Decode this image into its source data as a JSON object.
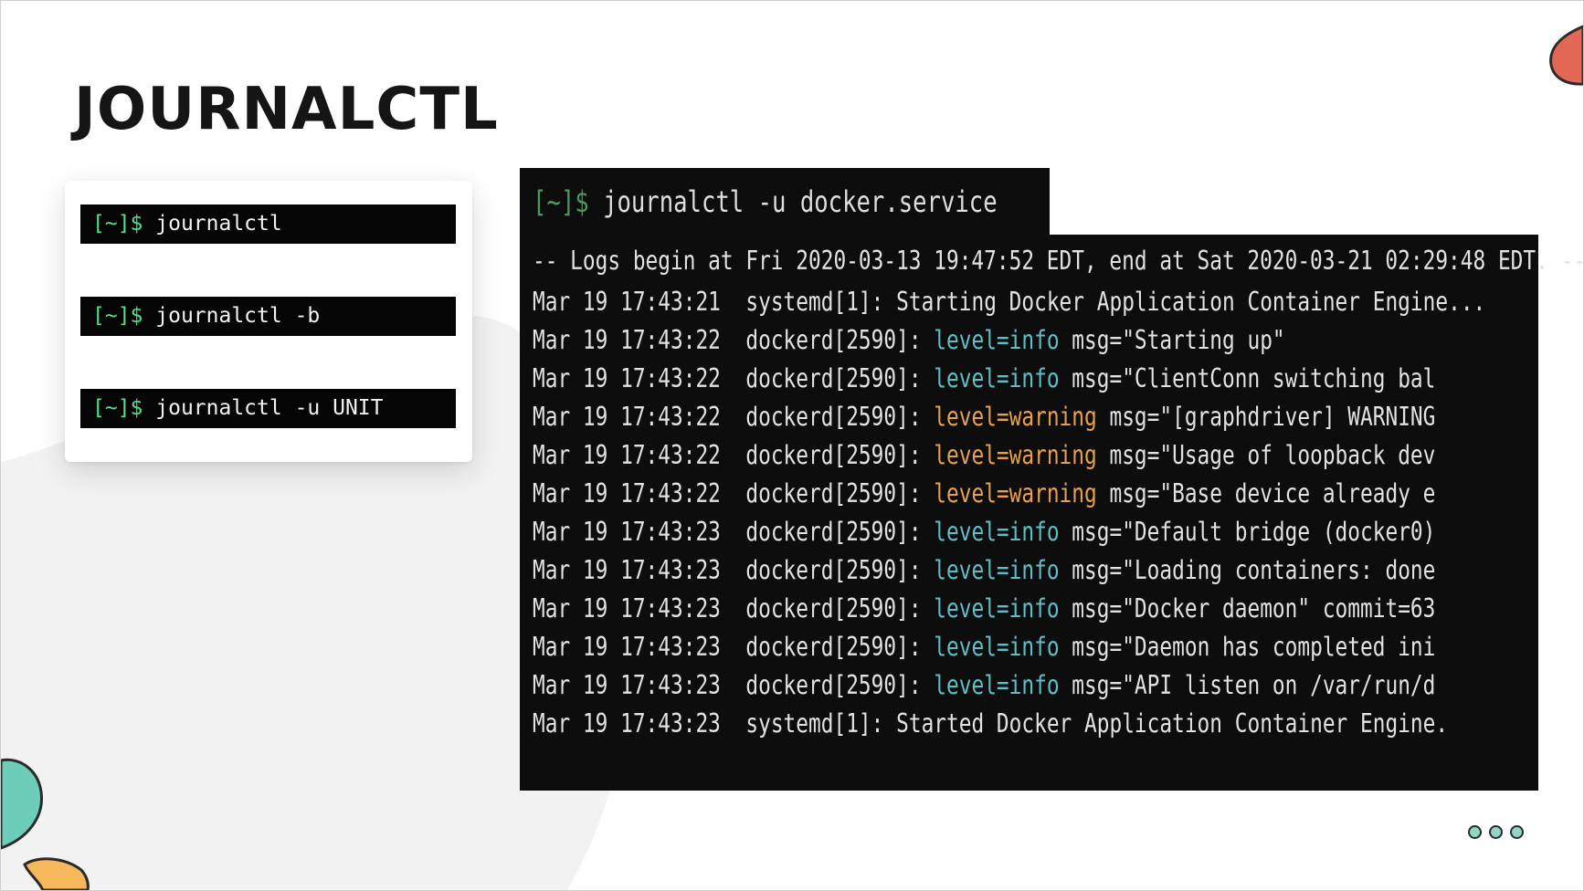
{
  "slide": {
    "title": "JOURNALCTL",
    "accent_colors": {
      "teal": "#6ccdb9",
      "orange": "#f6b85a",
      "red": "#e36755"
    }
  },
  "commands": [
    {
      "prompt": "[~]$",
      "command": "journalctl"
    },
    {
      "prompt": "[~]$",
      "command": "journalctl -b"
    },
    {
      "prompt": "[~]$",
      "command": "journalctl -u UNIT"
    }
  ],
  "terminal": {
    "prompt": "[~]$",
    "command": "journalctl -u docker.service",
    "header_line": "-- Logs begin at Fri 2020-03-13 19:47:52 EDT, end at Sat 2020-03-21 02:29:48 EDT. --",
    "lines": [
      {
        "ts": "Mar 19 17:43:21",
        "src": "systemd[1]:",
        "level": "",
        "msg": "Starting Docker Application Container Engine..."
      },
      {
        "ts": "Mar 19 17:43:22",
        "src": "dockerd[2590]:",
        "level": "level=info",
        "msg": "msg=\"Starting up\""
      },
      {
        "ts": "Mar 19 17:43:22",
        "src": "dockerd[2590]:",
        "level": "level=info",
        "msg": "msg=\"ClientConn switching bal"
      },
      {
        "ts": "Mar 19 17:43:22",
        "src": "dockerd[2590]:",
        "level": "level=warning",
        "msg": "msg=\"[graphdriver] WARNING"
      },
      {
        "ts": "Mar 19 17:43:22",
        "src": "dockerd[2590]:",
        "level": "level=warning",
        "msg": "msg=\"Usage of loopback dev"
      },
      {
        "ts": "Mar 19 17:43:22",
        "src": "dockerd[2590]:",
        "level": "level=warning",
        "msg": "msg=\"Base device already e"
      },
      {
        "ts": "Mar 19 17:43:23",
        "src": "dockerd[2590]:",
        "level": "level=info",
        "msg": "msg=\"Default bridge (docker0)"
      },
      {
        "ts": "Mar 19 17:43:23",
        "src": "dockerd[2590]:",
        "level": "level=info",
        "msg": "msg=\"Loading containers: done"
      },
      {
        "ts": "Mar 19 17:43:23",
        "src": "dockerd[2590]:",
        "level": "level=info",
        "msg": "msg=\"Docker daemon\" commit=63"
      },
      {
        "ts": "Mar 19 17:43:23",
        "src": "dockerd[2590]:",
        "level": "level=info",
        "msg": "msg=\"Daemon has completed ini"
      },
      {
        "ts": "Mar 19 17:43:23",
        "src": "dockerd[2590]:",
        "level": "level=info",
        "msg": "msg=\"API listen on /var/run/d"
      },
      {
        "ts": "Mar 19 17:43:23",
        "src": "systemd[1]:",
        "level": "",
        "msg": "Started Docker Application Container Engine."
      }
    ]
  },
  "nav": {
    "icon": "more-dots-icon"
  }
}
